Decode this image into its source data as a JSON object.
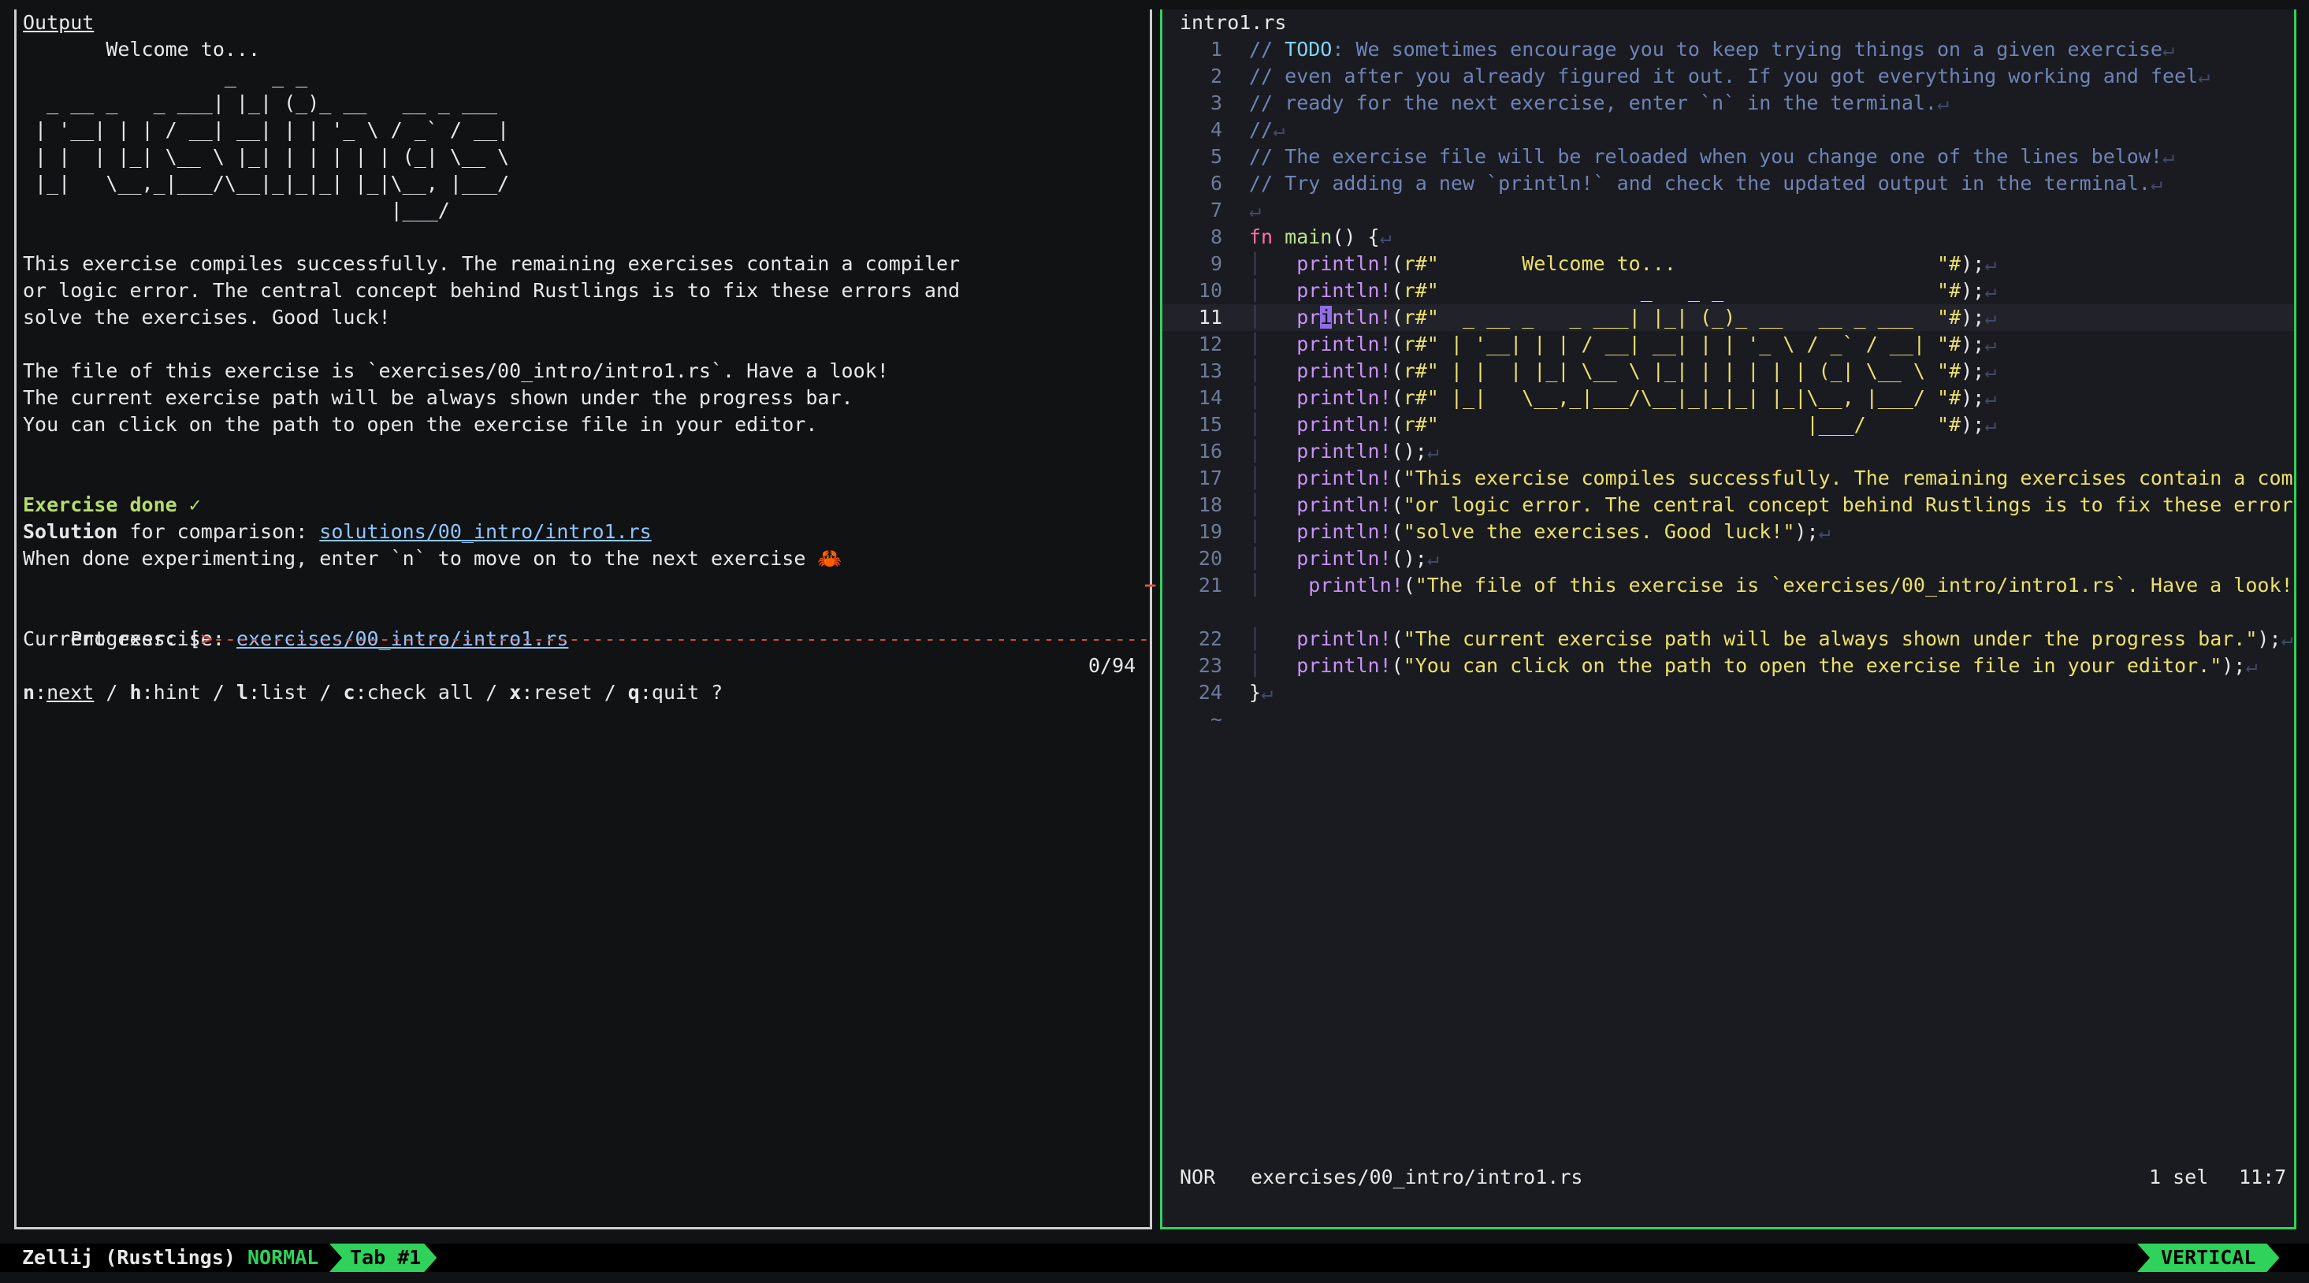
{
  "output": {
    "header": "Output",
    "welcome": "       Welcome to...",
    "ascii": [
      "                 _   _ _",
      "  _ __ _   _ ___| |_| (_)_ __   __ _ ___",
      " | '__| | | / __| __| | | '_ \\ / _` / __|",
      " | |  | |_| \\__ \\ |_| | | | | | (_| \\__ \\",
      " |_|   \\__,_|___/\\__|_|_|_| |_|\\__, |___/",
      "                               |___/"
    ],
    "para1": [
      "This exercise compiles successfully. The remaining exercises contain a compiler",
      "or logic error. The central concept behind Rustlings is to fix these errors and",
      "solve the exercises. Good luck!"
    ],
    "para2": [
      "The file of this exercise is `exercises/00_intro/intro1.rs`. Have a look!",
      "The current exercise path will be always shown under the progress bar.",
      "You can click on the path to open the exercise file in your editor."
    ],
    "done": "Exercise done ✓",
    "solution_label": "Solution",
    "solution_rest": " for comparison: ",
    "solution_path": "solutions/00_intro/intro1.rs",
    "next_msg": "When done experimenting, enter `n` to move on to the next exercise 🦀",
    "progress_label": "Progress: [",
    "progress_arrow": ">",
    "progress_end": "]",
    "progress_count": "0/94",
    "progress": {
      "done": 0,
      "total": 94
    },
    "current_label": "Current exercise: ",
    "current_path": "exercises/00_intro/intro1.rs",
    "keys": [
      {
        "k": "n",
        "sep": ":",
        "label": "next",
        "ul": true,
        "tail": " / "
      },
      {
        "k": "h",
        "sep": ":",
        "label": "hint",
        "ul": false,
        "tail": " / "
      },
      {
        "k": "l",
        "sep": ":",
        "label": "list",
        "ul": false,
        "tail": " / "
      },
      {
        "k": "c",
        "sep": ":",
        "label": "check all",
        "ul": false,
        "tail": " / "
      },
      {
        "k": "x",
        "sep": ":",
        "label": "reset",
        "ul": false,
        "tail": " / "
      },
      {
        "k": "q",
        "sep": ":",
        "label": "quit ?",
        "ul": false,
        "tail": ""
      }
    ]
  },
  "editor": {
    "title": "intro1.rs",
    "eol": "↵",
    "lines": [
      {
        "n": "1",
        "t": [
          [
            "cmt",
            "// "
          ],
          [
            "todo",
            "TODO"
          ],
          [
            "cmt",
            ": We sometimes encourage you to keep trying things on a given exercise"
          ]
        ]
      },
      {
        "n": "2",
        "t": [
          [
            "cmt",
            "// even after you already figured it out. If you got everything working and feel"
          ]
        ]
      },
      {
        "n": "3",
        "t": [
          [
            "cmt",
            "// ready for the next exercise, enter `n` in the terminal."
          ]
        ]
      },
      {
        "n": "4",
        "t": [
          [
            "cmt",
            "//"
          ]
        ]
      },
      {
        "n": "5",
        "t": [
          [
            "cmt",
            "// The exercise file will be reloaded when you change one of the lines below!"
          ]
        ]
      },
      {
        "n": "6",
        "t": [
          [
            "cmt",
            "// Try adding a new `println!` and check the updated output in the terminal."
          ]
        ]
      },
      {
        "n": "7",
        "t": []
      },
      {
        "n": "8",
        "t": [
          [
            "kw",
            "fn "
          ],
          [
            "fn",
            "main"
          ],
          [
            "pun",
            "() {"
          ]
        ]
      },
      {
        "n": "9",
        "g": true,
        "t": [
          [
            "mac",
            "println!"
          ],
          [
            "pun",
            "("
          ],
          [
            "str",
            "r#\"       Welcome to...                      \"#"
          ],
          [
            "pun",
            ");"
          ]
        ]
      },
      {
        "n": "10",
        "g": true,
        "t": [
          [
            "mac",
            "println!"
          ],
          [
            "pun",
            "("
          ],
          [
            "str",
            "r#\"                 _   _ _                  \"#"
          ],
          [
            "pun",
            ");"
          ]
        ]
      },
      {
        "n": "11",
        "g": true,
        "cur": true,
        "t": [
          [
            "mac",
            "pr"
          ],
          [
            "cur",
            "i"
          ],
          [
            "mac",
            "ntln!"
          ],
          [
            "pun",
            "("
          ],
          [
            "str",
            "r#\"  _ __ _   _ ___| |_| (_)_ __   __ _ ___  \"#"
          ],
          [
            "pun",
            ");"
          ]
        ]
      },
      {
        "n": "12",
        "g": true,
        "t": [
          [
            "mac",
            "println!"
          ],
          [
            "pun",
            "("
          ],
          [
            "str",
            "r#\" | '__| | | / __| __| | | '_ \\ / _` / __| \"#"
          ],
          [
            "pun",
            ");"
          ]
        ]
      },
      {
        "n": "13",
        "g": true,
        "t": [
          [
            "mac",
            "println!"
          ],
          [
            "pun",
            "("
          ],
          [
            "str",
            "r#\" | |  | |_| \\__ \\ |_| | | | | | (_| \\__ \\ \"#"
          ],
          [
            "pun",
            ");"
          ]
        ]
      },
      {
        "n": "14",
        "g": true,
        "t": [
          [
            "mac",
            "println!"
          ],
          [
            "pun",
            "("
          ],
          [
            "str",
            "r#\" |_|   \\__,_|___/\\__|_|_|_| |_|\\__, |___/ \"#"
          ],
          [
            "pun",
            ");"
          ]
        ]
      },
      {
        "n": "15",
        "g": true,
        "t": [
          [
            "mac",
            "println!"
          ],
          [
            "pun",
            "("
          ],
          [
            "str",
            "r#\"                               |___/      \"#"
          ],
          [
            "pun",
            ");"
          ]
        ]
      },
      {
        "n": "16",
        "g": true,
        "t": [
          [
            "mac",
            "println!"
          ],
          [
            "pun",
            "();"
          ]
        ]
      },
      {
        "n": "17",
        "g": true,
        "t": [
          [
            "mac",
            "println!"
          ],
          [
            "pun",
            "("
          ],
          [
            "str",
            "\"This exercise compiles successfully. The remaining exercises contain a com"
          ]
        ]
      },
      {
        "n": "18",
        "g": true,
        "t": [
          [
            "mac",
            "println!"
          ],
          [
            "pun",
            "("
          ],
          [
            "str",
            "\"or logic error. The central concept behind Rustlings is to fix these error"
          ]
        ]
      },
      {
        "n": "19",
        "g": true,
        "t": [
          [
            "mac",
            "println!"
          ],
          [
            "pun",
            "("
          ],
          [
            "str",
            "\"solve the exercises. Good luck!\""
          ],
          [
            "pun",
            ");"
          ]
        ]
      },
      {
        "n": "20",
        "g": true,
        "t": [
          [
            "mac",
            "println!"
          ],
          [
            "pun",
            "();"
          ]
        ]
      },
      {
        "n": "21",
        "g": true,
        "t": [
          [
            "mac",
            " println!"
          ],
          [
            "pun",
            "("
          ],
          [
            "str",
            "\"The file of this exercise is `exercises/00_intro/intro1.rs`. Have a look!\""
          ]
        ]
      },
      {
        "n": "",
        "blank": true,
        "t": []
      },
      {
        "n": "22",
        "g": true,
        "t": [
          [
            "mac",
            "println!"
          ],
          [
            "pun",
            "("
          ],
          [
            "str",
            "\"The current exercise path will be always shown under the progress bar.\""
          ],
          [
            "pun",
            ");"
          ]
        ]
      },
      {
        "n": "23",
        "g": true,
        "t": [
          [
            "mac",
            "println!"
          ],
          [
            "pun",
            "("
          ],
          [
            "str",
            "\"You can click on the path to open the exercise file in your editor.\""
          ],
          [
            "pun",
            ");"
          ]
        ]
      },
      {
        "n": "24",
        "t": [
          [
            "pun",
            "}"
          ]
        ]
      },
      {
        "n": "~",
        "tilde": true,
        "t": []
      }
    ],
    "status": {
      "mode": "NOR",
      "file": "exercises/00_intro/intro1.rs",
      "sel": "1 sel",
      "pos": "11:7"
    }
  },
  "zellij": {
    "session": "Zellij (Rustlings)",
    "mode": "NORMAL",
    "tab": "Tab #1",
    "layout": "VERTICAL"
  }
}
